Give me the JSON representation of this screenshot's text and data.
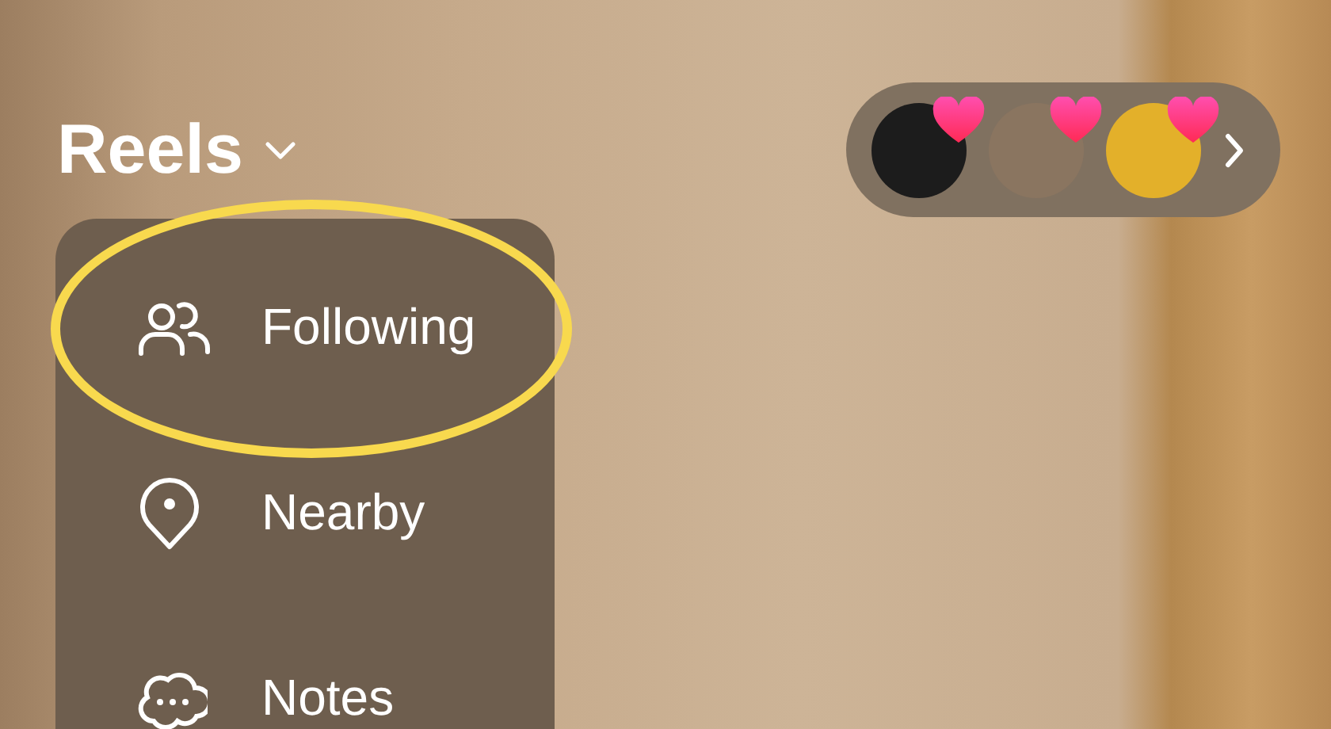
{
  "header": {
    "title": "Reels",
    "menu_open": true
  },
  "liked_by": [
    {
      "liked": true,
      "color": "#1c1c1c"
    },
    {
      "liked": true,
      "color": "#8a7560"
    },
    {
      "liked": true,
      "color": "#e3b02a"
    }
  ],
  "menu": {
    "items": [
      {
        "kind": "following",
        "label": "Following",
        "highlighted": true
      },
      {
        "kind": "nearby",
        "label": "Nearby",
        "highlighted": false
      },
      {
        "kind": "notes",
        "label": "Notes",
        "highlighted": false
      }
    ]
  }
}
